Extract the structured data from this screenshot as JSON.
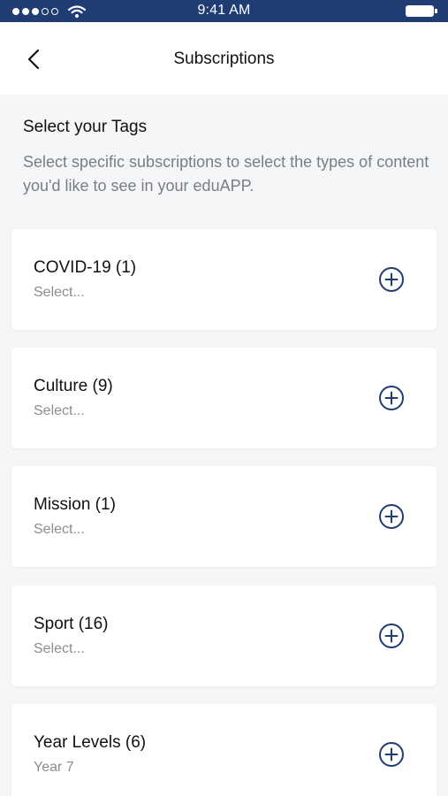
{
  "status_bar": {
    "time": "9:41 AM",
    "signal_icon": "signal-dots-icon",
    "wifi_icon": "wifi-icon",
    "battery_icon": "battery-icon"
  },
  "header": {
    "title": "Subscriptions",
    "back_icon": "chevron-left-icon"
  },
  "intro": {
    "title": "Select your Tags",
    "description": "Select specific subscriptions to select the types of content you'd like to see in your eduAPP."
  },
  "tags": [
    {
      "label": "COVID-19 (1)",
      "value": "Select..."
    },
    {
      "label": "Culture (9)",
      "value": "Select..."
    },
    {
      "label": "Mission (1)",
      "value": "Select..."
    },
    {
      "label": "Sport (16)",
      "value": "Select..."
    },
    {
      "label": "Year Levels (6)",
      "value": "Year 7"
    }
  ],
  "colors": {
    "status_bar": "#1f3c73",
    "accent": "#1f3c73",
    "background": "#f5f6f8"
  }
}
